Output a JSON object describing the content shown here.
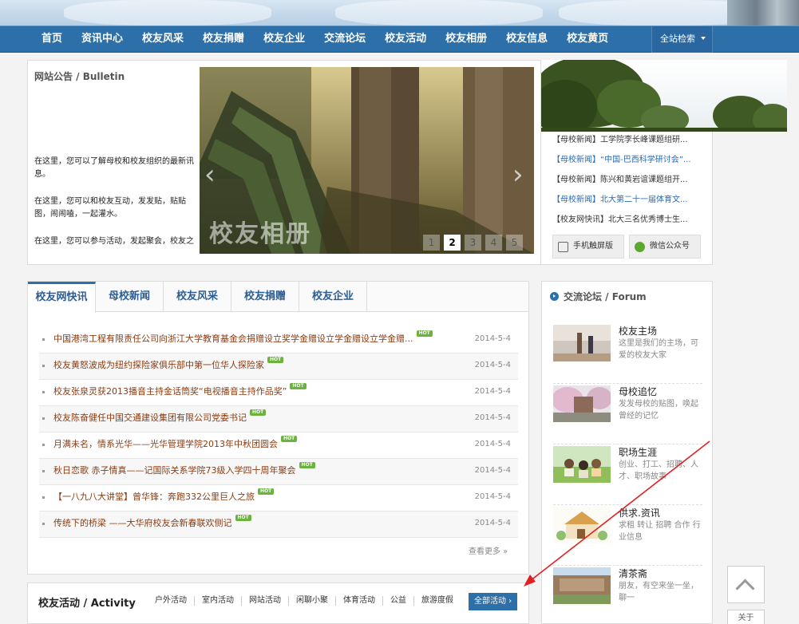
{
  "nav": {
    "items": [
      "首页",
      "资讯中心",
      "校友风采",
      "校友捐赠",
      "校友企业",
      "交流论坛",
      "校友活动",
      "校友相册",
      "校友信息",
      "校友黄页"
    ],
    "search_label": "全站检索"
  },
  "bulletin": {
    "title": "网站公告 / Bulletin",
    "paragraphs": [
      "在这里，您可以了解母校和校友组织的最新讯息。",
      "在这里，您可以和校友互动，发发贴，贴贴图，闹闹嗑，一起灌水。",
      "在这里，您可以参与活动，发起聚会，校友之间相聚的平台。"
    ]
  },
  "slideshow": {
    "caption": "校友相册",
    "prev_label": "‹",
    "next_label": "›",
    "pages": [
      "1",
      "2",
      "3",
      "4",
      "5"
    ],
    "active_page": 2
  },
  "right_news": {
    "items": [
      {
        "text": "【母校新闻】工学院李长峰课题组研...",
        "color": "#333333"
      },
      {
        "text": "【母校新闻】“中国-巴西科学研讨会”...",
        "color": "#2a68b0"
      },
      {
        "text": "【母校新闻】陈兴和黄岩谊课题组开...",
        "color": "#333333"
      },
      {
        "text": "【母校新闻】北大第二十一届体育文...",
        "color": "#2a68b0"
      },
      {
        "text": "【校友网快讯】北大三名优秀博士生...",
        "color": "#333333"
      }
    ],
    "mobile_label": "手机触屏版",
    "wechat_label": "微信公众号"
  },
  "tabs": [
    "校友网快讯",
    "母校新闻",
    "校友风采",
    "校友捐赠",
    "校友企业"
  ],
  "news": {
    "items": [
      {
        "title": "中国港湾工程有限责任公司向浙江大学教育基金会捐赠设立奖学金赠设立学金赠设立学金赠...",
        "hot": "HOT",
        "date": "2014-5-4"
      },
      {
        "title": "校友黄怒波成为纽约探险家俱乐部中第一位华人探险家",
        "hot": "HOT",
        "date": "2014-5-4"
      },
      {
        "title": "校友张泉灵获2013播音主持金话筒奖“电视播音主持作品奖”",
        "hot": "HOT",
        "date": "2014-5-4"
      },
      {
        "title": "校友陈奋健任中国交通建设集团有限公司党委书记",
        "hot": "HOT",
        "date": "2014-5-4"
      },
      {
        "title": "月满未名，情系光华——光华管理学院2013年中秋团圆会",
        "hot": "HOT",
        "date": "2014-5-4"
      },
      {
        "title": "秋日恋歌 赤子情真——记国际关系学院73级入学四十周年聚会",
        "hot": "HOT",
        "date": "2014-5-4"
      },
      {
        "title": "【一八九八大讲堂】曾华锋：奔跑332公里巨人之旅",
        "hot": "HOT",
        "date": "2014-5-4"
      },
      {
        "title": "传统下的桥梁 ——大华府校友会新春联欢侧记",
        "hot": "HOT",
        "date": "2014-5-4"
      }
    ],
    "more_label": "查看更多 »"
  },
  "forum": {
    "title": "交流论坛 / Forum",
    "items": [
      {
        "name": "校友主场",
        "desc": "这里是我们的主场，可爱的校友大家"
      },
      {
        "name": "母校追忆",
        "desc": "发发母校的贴图，唤起曾经的记忆"
      },
      {
        "name": "职场生涯",
        "desc": "创业、打工、招聘、人才、职场故事"
      },
      {
        "name": "供求.资讯",
        "desc": "求租 转让 招聘 合作 行业信息"
      },
      {
        "name": "清茶斋",
        "desc": "朋友，有空来坐一坐，聊一"
      }
    ]
  },
  "activity": {
    "title": "校友活动 / Activity",
    "categories": [
      "户外活动",
      "室内活动",
      "网站活动",
      "闲聊小聚",
      "体育活动",
      "公益",
      "旅游度假"
    ],
    "all_label": "全部活动 ›"
  },
  "side": {
    "about_label": "关于"
  },
  "colors": {
    "nav_blue": "#2d6fa8",
    "news_text": "#8a3b12",
    "hot_green": "#6cb33e",
    "annotation_arrow": "#e02020"
  }
}
